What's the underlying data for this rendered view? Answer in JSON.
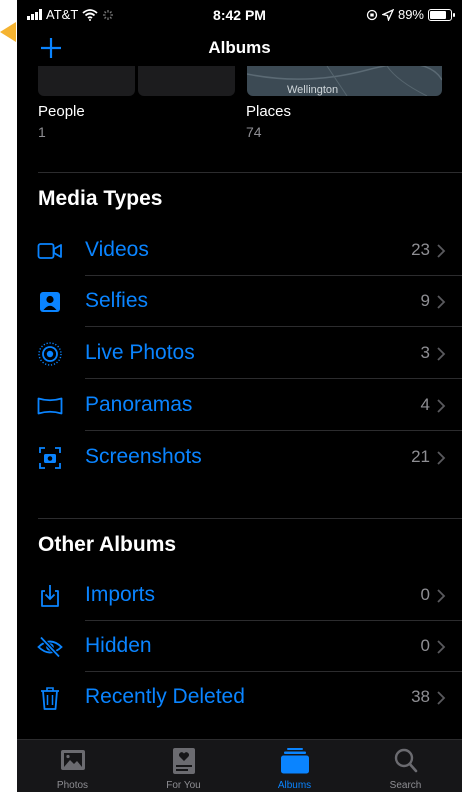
{
  "status_bar": {
    "carrier": "AT&T",
    "time": "8:42 PM",
    "battery": "89%",
    "battery_level": 0.89
  },
  "nav": {
    "title": "Albums",
    "add_icon": "plus-icon"
  },
  "top_albums": [
    {
      "name": "People",
      "count": "1"
    },
    {
      "name": "Places",
      "count": "74",
      "map_label": "Wellington"
    }
  ],
  "media_types": {
    "title": "Media Types",
    "items": [
      {
        "label": "Videos",
        "count": "23",
        "icon": "video-icon"
      },
      {
        "label": "Selfies",
        "count": "9",
        "icon": "selfie-icon"
      },
      {
        "label": "Live Photos",
        "count": "3",
        "icon": "live-photo-icon"
      },
      {
        "label": "Panoramas",
        "count": "4",
        "icon": "panorama-icon"
      },
      {
        "label": "Screenshots",
        "count": "21",
        "icon": "screenshot-icon"
      }
    ]
  },
  "other_albums": {
    "title": "Other Albums",
    "items": [
      {
        "label": "Imports",
        "count": "0",
        "icon": "import-icon"
      },
      {
        "label": "Hidden",
        "count": "0",
        "icon": "hidden-icon"
      },
      {
        "label": "Recently Deleted",
        "count": "38",
        "icon": "trash-icon"
      }
    ]
  },
  "tab_bar": {
    "tabs": [
      {
        "label": "Photos",
        "icon": "photos-icon",
        "active": false
      },
      {
        "label": "For You",
        "icon": "for-you-icon",
        "active": false
      },
      {
        "label": "Albums",
        "icon": "albums-icon",
        "active": true
      },
      {
        "label": "Search",
        "icon": "search-icon",
        "active": false
      }
    ]
  },
  "colors": {
    "background": "#000000",
    "accent": "#0a84ff",
    "secondary_text": "#8e8e93",
    "separator": "#2c2c2e",
    "corner_highlight": "#f5b331"
  }
}
